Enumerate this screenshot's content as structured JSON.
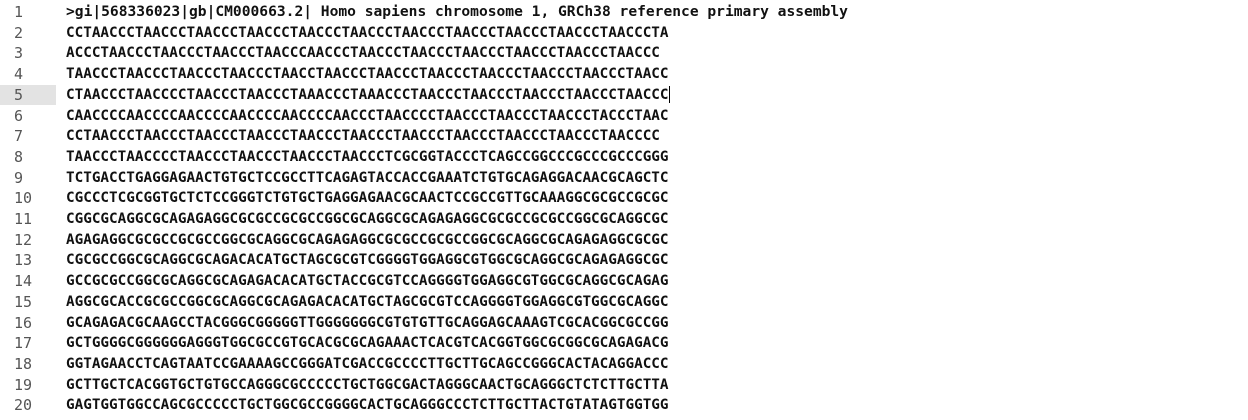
{
  "editor": {
    "current_line": 5,
    "lines": [
      {
        "number": "1",
        "text": ">gi|568336023|gb|CM000663.2| Homo sapiens chromosome 1, GRCh38 reference primary assembly"
      },
      {
        "number": "2",
        "text": "CCTAACCCTAACCCTAACCCTAACCCTAACCCTAACCCTAACCCTAACCCTAACCCTAACCCTAACCCTA"
      },
      {
        "number": "3",
        "text": "ACCCTAACCCTAACCCTAACCCTAACCCAACCCTAACCCTAACCCTAACCCTAACCCTAACCCTAACCC"
      },
      {
        "number": "4",
        "text": "TAACCCTAACCCTAACCCTAACCCTAACCTAACCCTAACCCTAACCCTAACCCTAACCCTAACCCTAACC"
      },
      {
        "number": "5",
        "text": "CTAACCCTAACCCCTAACCCTAACCCTAAACCCTAAACCCTAACCCTAACCCTAACCCTAACCCTAACCC"
      },
      {
        "number": "6",
        "text": "CAACCCCAACCCCAACCCCAACCCCAACCCCAACCCTAACCCCTAACCCTAACCCTAACCCTACCCTAAC"
      },
      {
        "number": "7",
        "text": "CCTAACCCTAACCCTAACCCTAACCCTAACCCTAACCCTAACCCTAACCCTAACCCTAACCCTAACCCC"
      },
      {
        "number": "8",
        "text": "TAACCCTAACCCCTAACCCTAACCCTAACCCTAACCCTCGCGGTACCCTCAGCCGGCCCGCCCGCCCGGG"
      },
      {
        "number": "9",
        "text": "TCTGACCTGAGGAGAACTGTGCTCCGCCTTCAGAGTACCACCGAAATCTGTGCAGAGGACAACGCAGCTC"
      },
      {
        "number": "10",
        "text": "CGCCCTCGCGGTGCTCTCCGGGTCTGTGCTGAGGAGAACGCAACTCCGCCGTTGCAAAGGCGCGCCGCGC"
      },
      {
        "number": "11",
        "text": "CGGCGCAGGCGCAGAGAGGCGCGCCGCGCCGGCGCAGGCGCAGAGAGGCGCGCCGCGCCGGCGCAGGCGC"
      },
      {
        "number": "12",
        "text": "AGAGAGGCGCGCCGCGCCGGCGCAGGCGCAGAGAGGCGCGCCGCGCCGGCGCAGGCGCAGAGAGGCGCGC"
      },
      {
        "number": "13",
        "text": "CGCGCCGGCGCAGGCGCAGACACATGCTAGCGCGTCGGGGTGGAGGCGTGGCGCAGGCGCAGAGAGGCGC"
      },
      {
        "number": "14",
        "text": "GCCGCGCCGGCGCAGGCGCAGAGACACATGCTACCGCGTCCAGGGGTGGAGGCGTGGCGCAGGCGCAGAG"
      },
      {
        "number": "15",
        "text": "AGGCGCACCGCGCCGGCGCAGGCGCAGAGACACATGCTAGCGCGTCCAGGGGTGGAGGCGTGGCGCAGGC"
      },
      {
        "number": "16",
        "text": "GCAGAGACGCAAGCCTACGGGCGGGGGTTGGGGGGGCGTGTGTTGCAGGAGCAAAGTCGCACGGCGCCGG"
      },
      {
        "number": "17",
        "text": "GCTGGGGCGGGGGGAGGGTGGCGCCGTGCACGCGCAGAAACTCACGTCACGGTGGCGCGGCGCAGAGACG"
      },
      {
        "number": "18",
        "text": "GGTAGAACCTCAGTAATCCGAAAAGCCGGGATCGACCGCCCCTTGCTTGCAGCCGGGCACTACAGGACCC"
      },
      {
        "number": "19",
        "text": "GCTTGCTCACGGTGCTGTGCCAGGGCGCCCCCTGCTGGCGACTAGGGCAACTGCAGGGCTCTCTTGCTTA"
      },
      {
        "number": "20",
        "text": "GAGTGGTGGCCAGCGCCCCCTGCTGGCGCCGGGGCACTGCAGGGCCCTCTTGCTTACTGTATAGTGGTGG"
      }
    ]
  }
}
